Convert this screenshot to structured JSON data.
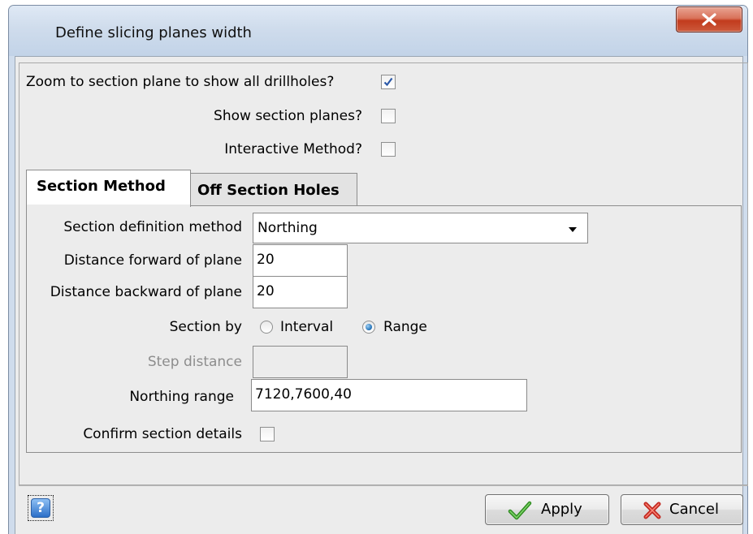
{
  "window": {
    "title": "Define slicing planes width",
    "close_icon": "close-x-icon"
  },
  "options": {
    "zoom_label": "Zoom to section plane to show all drillholes?",
    "zoom_checked": true,
    "show_planes_label": "Show section planes?",
    "show_planes_checked": false,
    "interactive_label": "Interactive Method?",
    "interactive_checked": false
  },
  "tabs": [
    {
      "label": "Section Method",
      "active": true
    },
    {
      "label": "Off Section Holes",
      "active": false
    }
  ],
  "section_method": {
    "definition_label": "Section definition method",
    "definition_value": "Northing",
    "forward_label": "Distance forward of plane",
    "forward_value": "20",
    "backward_label": "Distance backward of plane",
    "backward_value": "20",
    "section_by_label": "Section by",
    "interval_label": "Interval",
    "range_label": "Range",
    "section_by_selected": "Range",
    "step_label": "Step distance",
    "step_value": "",
    "northing_label": "Northing range",
    "northing_value": "7120,7600,40",
    "confirm_label": "Confirm section details",
    "confirm_checked": false
  },
  "buttons": {
    "help_icon": "help-question-icon",
    "help_glyph": "?",
    "apply_label": "Apply",
    "apply_icon": "checkmark-icon",
    "cancel_label": "Cancel",
    "cancel_icon": "x-cross-icon"
  },
  "colors": {
    "frame": "#cfdcec",
    "close_button": "#c94e33",
    "checkmark": "#2e8b1f",
    "cancel_cross": "#d0302a",
    "radio_selected": "#1f6fb5"
  }
}
